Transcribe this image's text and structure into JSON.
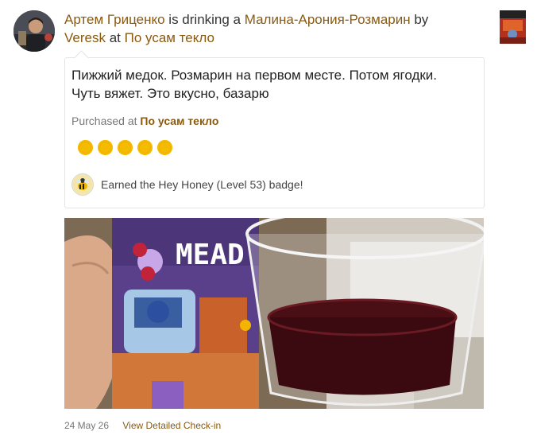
{
  "checkin": {
    "user_name": "Артем Гриценко",
    "is_drinking_text": "is drinking a",
    "beer_name": "Малина-Арония-Розмарин",
    "by_text": "by",
    "brewery": "Veresk",
    "at_text": "at",
    "venue": "По усам текло",
    "comment": "Пижжий медок. Розмарин на первом месте. Потом ягодки. Чуть вяжет. Это вкусно, базарю",
    "purchased_label": "Purchased at",
    "purchased_venue": "По усам текло",
    "rating": 5,
    "rating_max": 5,
    "badge_text": "Earned the Hey Honey (Level 53) badge!",
    "photo_can_text": "MEAD",
    "date": "24 May 26",
    "view_link": "View Detailed Check-in"
  },
  "colors": {
    "link": "#8a5a10",
    "rating_cap": "#f5bb00",
    "text": "#333333"
  }
}
